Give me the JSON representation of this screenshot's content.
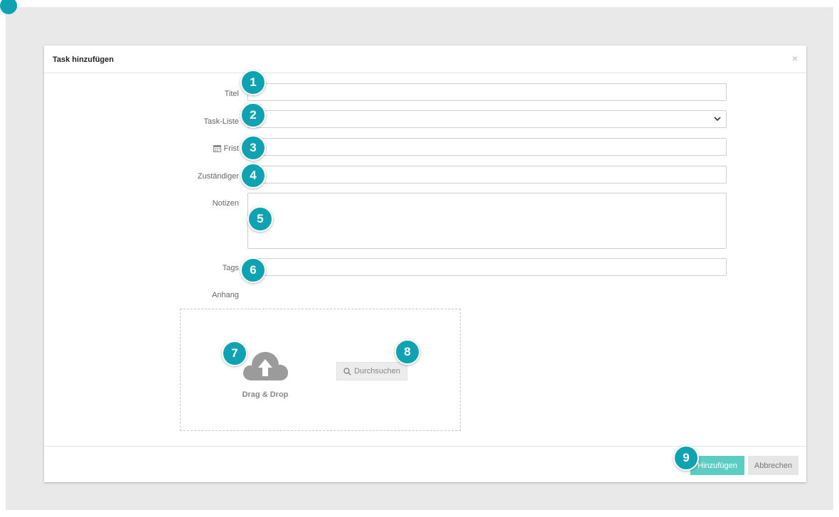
{
  "dialog": {
    "title": "Task hinzufügen",
    "close_label": "×"
  },
  "form": {
    "fields": [
      {
        "label": "Titel",
        "value": "",
        "badge": "1"
      },
      {
        "label": "Task-Liste",
        "value": "",
        "badge": "2"
      },
      {
        "label": "Frist",
        "value": "",
        "badge": "3"
      },
      {
        "label": "Zuständiger",
        "value": "",
        "badge": "4"
      },
      {
        "label": "Notizen",
        "value": "",
        "badge": "5"
      },
      {
        "label": "Tags",
        "value": "",
        "badge": "6"
      }
    ],
    "attachment_label": "Anhang"
  },
  "upload": {
    "drag_drop_label": "Drag & Drop",
    "browse_label": "Durchsuchen",
    "badge_dropzone": "7",
    "badge_browse": "8"
  },
  "footer": {
    "submit_label": "Hinzufügen",
    "cancel_label": "Abbrechen",
    "badge_submit": "9"
  },
  "colors": {
    "badge": "#0fa3b1",
    "primary_button": "#5ccdc2",
    "backdrop": "#e9e9e9"
  },
  "icons": [
    "close-icon",
    "calendar-icon",
    "chevron-down-icon",
    "cloud-upload-icon",
    "search-icon"
  ]
}
